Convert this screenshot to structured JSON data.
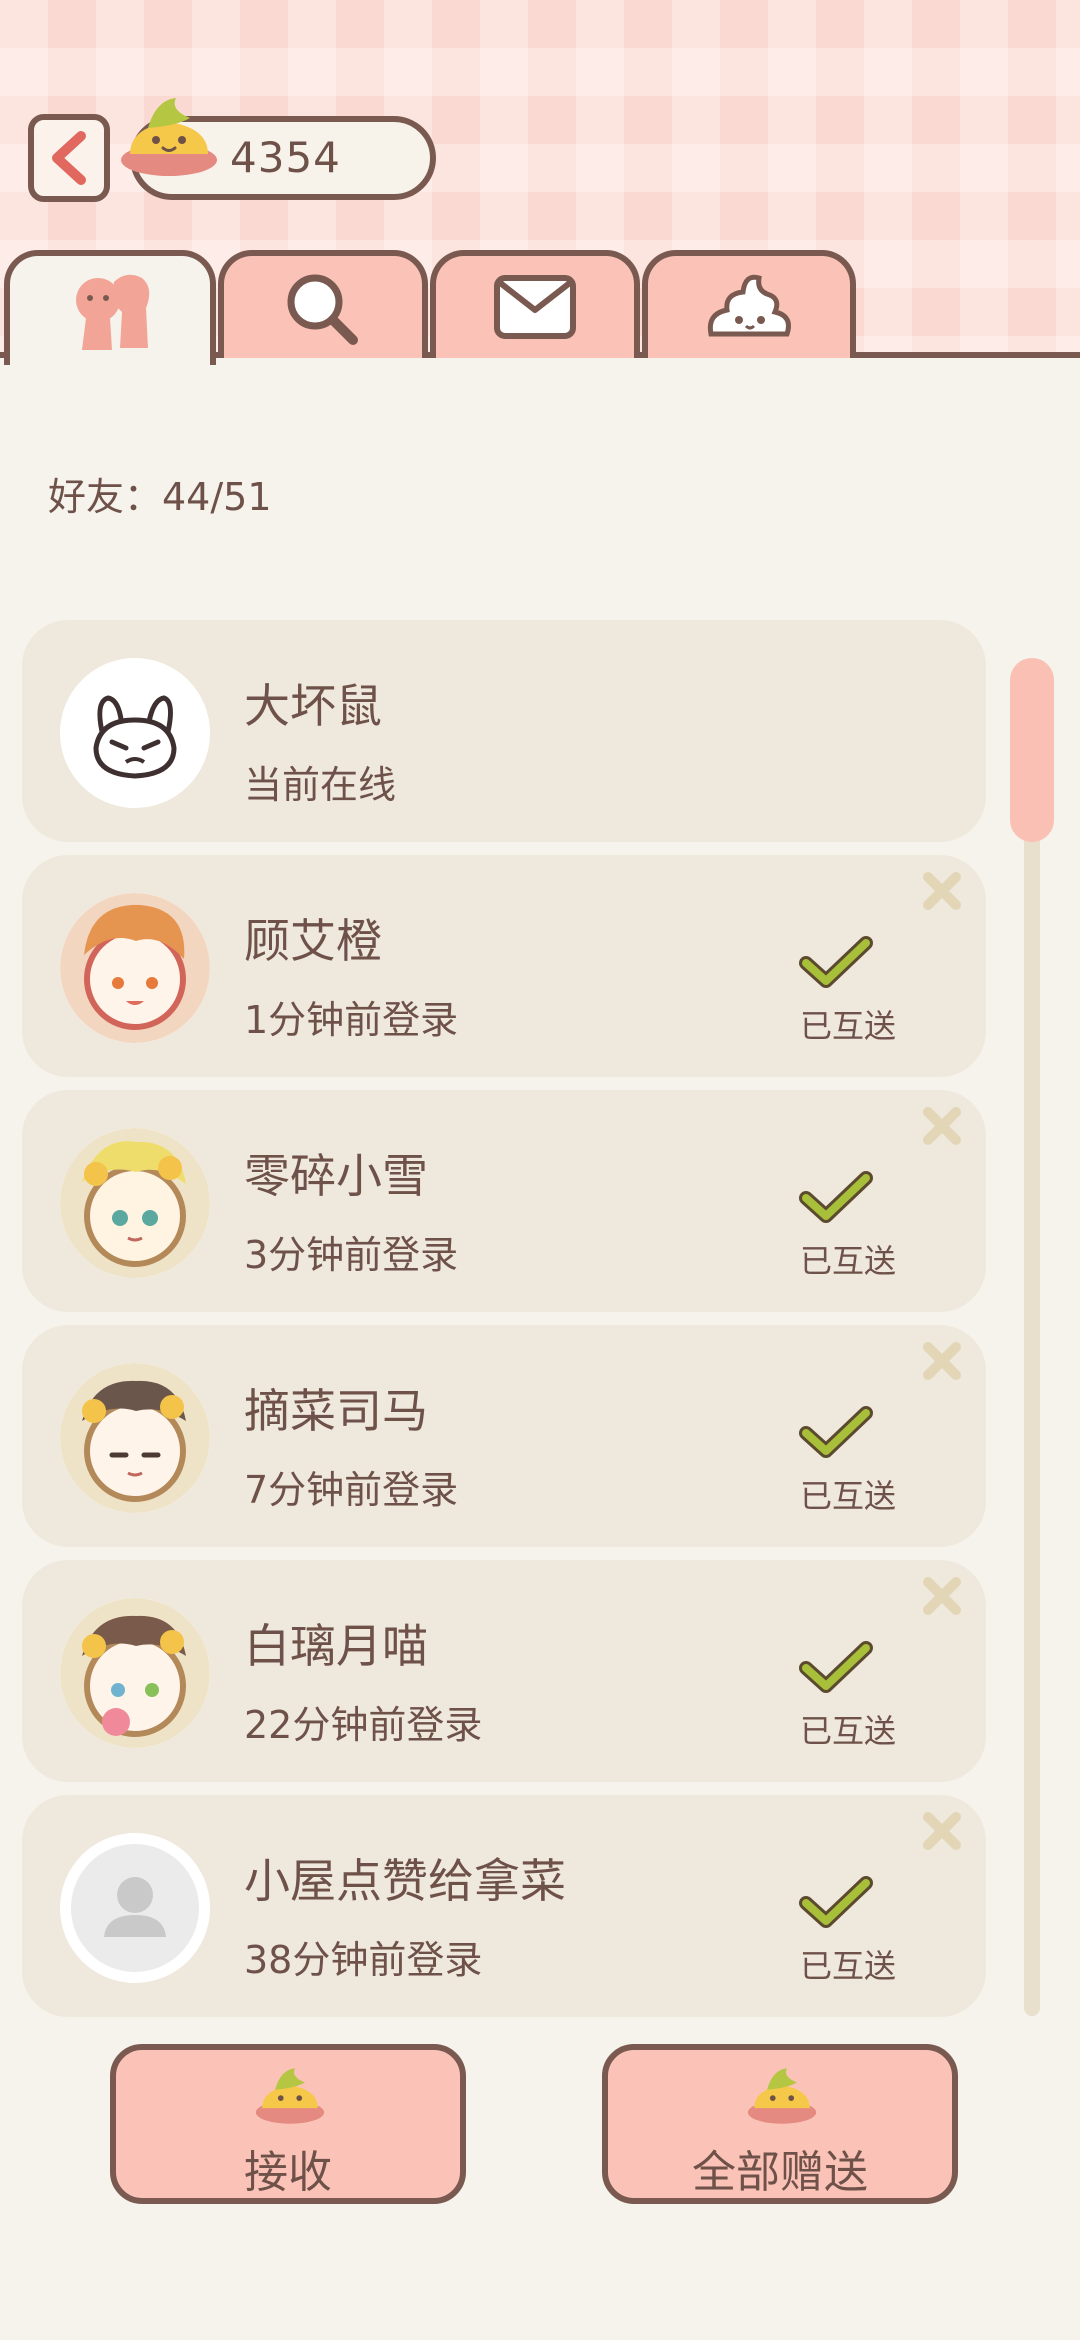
{
  "header": {
    "currency_value": "4354",
    "back_icon": "chevron-left-icon",
    "currency_icon": "poop-coin-icon"
  },
  "tabs": [
    {
      "icon": "friends-icon",
      "active": true
    },
    {
      "icon": "search-icon",
      "active": false
    },
    {
      "icon": "mail-icon",
      "active": false
    },
    {
      "icon": "poop-icon",
      "active": false
    }
  ],
  "friends_count": "好友：44/51",
  "friends": [
    {
      "name": "大坏鼠",
      "status": "当前在线",
      "sent_label": ""
    },
    {
      "name": "顾艾橙",
      "status": "1分钟前登录",
      "sent_label": "已互送"
    },
    {
      "name": "零碎小雪",
      "status": "3分钟前登录",
      "sent_label": "已互送"
    },
    {
      "name": "摘菜司马",
      "status": "7分钟前登录",
      "sent_label": "已互送"
    },
    {
      "name": "白璃月喵",
      "status": "22分钟前登录",
      "sent_label": "已互送"
    },
    {
      "name": "小屋点赞给拿菜",
      "status": "38分钟前登录",
      "sent_label": "已互送"
    }
  ],
  "buttons": {
    "receive_label": "接收",
    "send_all_label": "全部赠送"
  },
  "colors": {
    "accent": "#fbc3b8",
    "outline": "#7a5a50",
    "check": "#a8bf3a",
    "background": "#f6f3ed"
  }
}
